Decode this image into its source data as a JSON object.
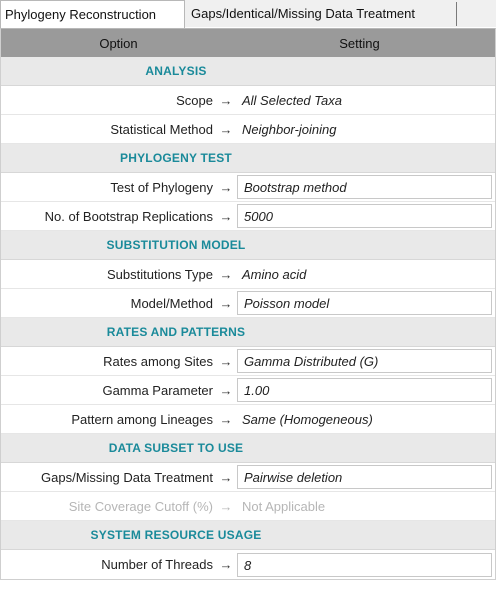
{
  "tabs": [
    {
      "label": "Phylogeny Reconstruction",
      "active": true
    },
    {
      "label": "Gaps/Identical/Missing Data Treatment",
      "active": false
    }
  ],
  "header": {
    "option": "Option",
    "setting": "Setting"
  },
  "arrow": "→",
  "sections": {
    "analysis": "ANALYSIS",
    "phylogeny_test": "PHYLOGENY TEST",
    "substitution_model": "SUBSTITUTION MODEL",
    "rates_patterns": "RATES AND PATTERNS",
    "data_subset": "DATA SUBSET TO USE",
    "system_resource": "SYSTEM RESOURCE USAGE"
  },
  "rows": {
    "scope": {
      "label": "Scope",
      "value": "All Selected Taxa"
    },
    "stat_method": {
      "label": "Statistical Method",
      "value": "Neighbor-joining"
    },
    "test_phylogeny": {
      "label": "Test of Phylogeny",
      "value": "Bootstrap method"
    },
    "bootstrap_reps": {
      "label": "No. of Bootstrap Replications",
      "value": "5000"
    },
    "subst_type": {
      "label": "Substitutions Type",
      "value": "Amino acid"
    },
    "model_method": {
      "label": "Model/Method",
      "value": "Poisson model"
    },
    "rates_sites": {
      "label": "Rates among Sites",
      "value": "Gamma Distributed (G)"
    },
    "gamma_param": {
      "label": "Gamma Parameter",
      "value": "1.00"
    },
    "pattern_lineages": {
      "label": "Pattern among Lineages",
      "value": "Same (Homogeneous)"
    },
    "gaps_treatment": {
      "label": "Gaps/Missing Data Treatment",
      "value": "Pairwise deletion"
    },
    "site_coverage": {
      "label": "Site Coverage Cutoff (%)",
      "value": "Not Applicable"
    },
    "threads": {
      "label": "Number of Threads",
      "value": "8"
    }
  },
  "colors": {
    "section_text": "#1a8a9a",
    "header_bg": "#9a9a9a",
    "section_bg": "#e9e9e9",
    "disabled_text": "#b6b6b6"
  }
}
